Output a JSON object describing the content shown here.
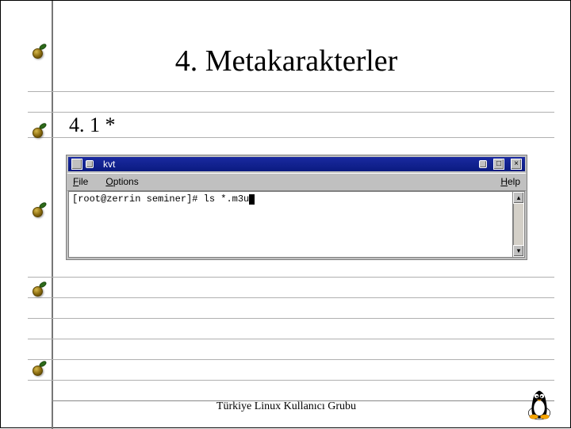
{
  "slide": {
    "title": "4. Metakarakterler",
    "subtitle": "4. 1 *",
    "footer": "Türkiye Linux Kullanıcı Grubu"
  },
  "window": {
    "title": "kvt",
    "menu": {
      "file": "File",
      "options": "Options",
      "help": "Help"
    },
    "terminal": {
      "prompt": "[root@zerrin seminer]# ",
      "command": "ls *.m3u"
    },
    "controls": {
      "minimize": "_",
      "maximize": "□",
      "close": "×"
    },
    "scroll": {
      "up": "▴",
      "down": "▾"
    }
  }
}
